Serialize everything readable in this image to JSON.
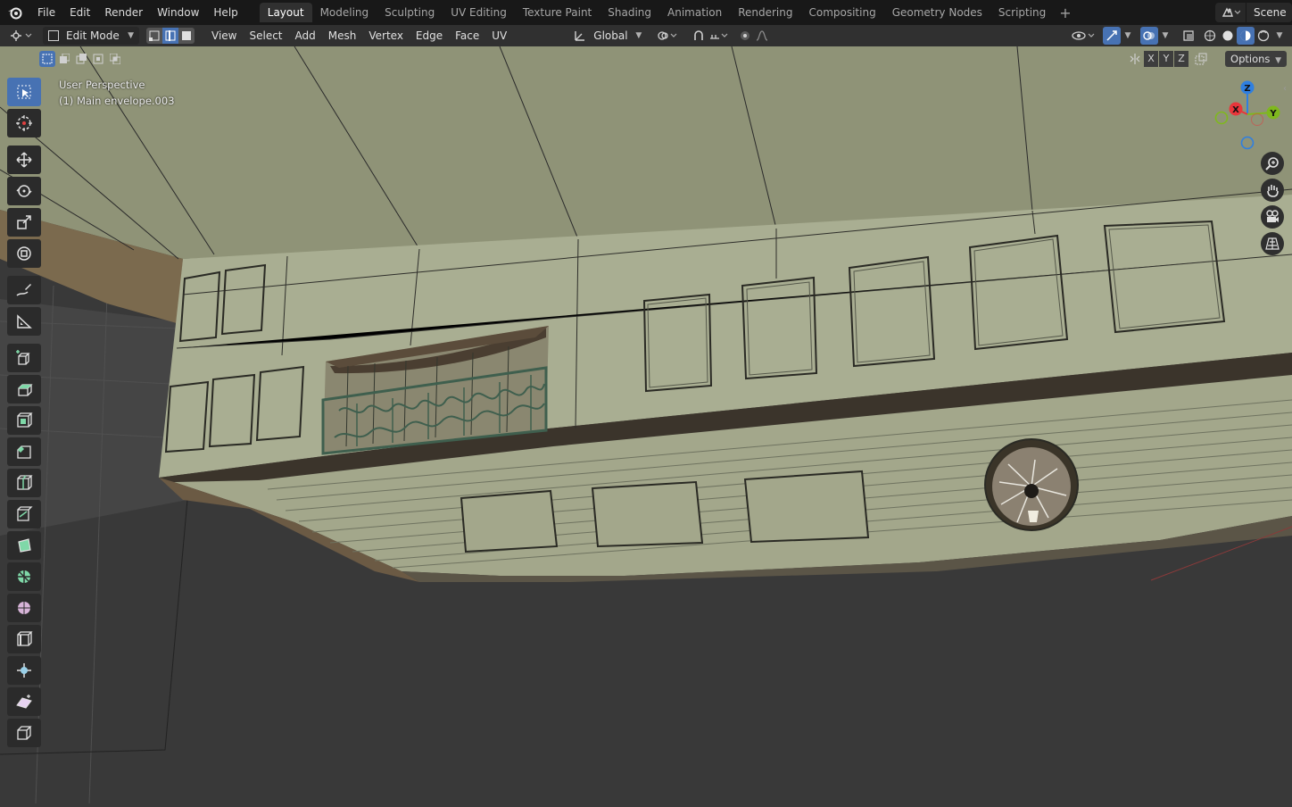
{
  "topbar": {
    "menus": [
      "File",
      "Edit",
      "Render",
      "Window",
      "Help"
    ],
    "workspaces": [
      "Layout",
      "Modeling",
      "Sculpting",
      "UV Editing",
      "Texture Paint",
      "Shading",
      "Animation",
      "Rendering",
      "Compositing",
      "Geometry Nodes",
      "Scripting"
    ],
    "active_workspace": "Layout",
    "scene_label": "Scene"
  },
  "header": {
    "mode": "Edit Mode",
    "menus": [
      "View",
      "Select",
      "Add",
      "Mesh",
      "Vertex",
      "Edge",
      "Face",
      "UV"
    ],
    "transform_orientation": "Global",
    "active_select_mode": "edge"
  },
  "viewport": {
    "perspective_label": "User Perspective",
    "object_label": "(1) Main envelope.003",
    "axis_lock": [
      "X",
      "Y",
      "Z"
    ],
    "options_label": "Options",
    "gizmo_axes": [
      "Z",
      "X",
      "Y"
    ]
  },
  "tools": [
    {
      "name": "select-box",
      "active": true
    },
    {
      "name": "cursor",
      "active": false
    },
    {
      "name": "move",
      "active": false
    },
    {
      "name": "rotate",
      "active": false
    },
    {
      "name": "scale",
      "active": false
    },
    {
      "name": "transform",
      "active": false
    },
    {
      "name": "annotate",
      "active": false
    },
    {
      "name": "measure",
      "active": false
    },
    {
      "name": "add-cube",
      "active": false
    },
    {
      "name": "extrude-region",
      "active": false
    },
    {
      "name": "inset-faces",
      "active": false
    },
    {
      "name": "bevel",
      "active": false
    },
    {
      "name": "loop-cut",
      "active": false
    },
    {
      "name": "knife",
      "active": false
    },
    {
      "name": "poly-build",
      "active": false
    },
    {
      "name": "spin",
      "active": false
    },
    {
      "name": "smooth",
      "active": false
    },
    {
      "name": "edge-slide",
      "active": false
    },
    {
      "name": "shrink-fatten",
      "active": false
    },
    {
      "name": "shear",
      "active": false
    },
    {
      "name": "rip-region",
      "active": false
    }
  ],
  "colors": {
    "accent": "#4772b3",
    "topbar_bg": "#181818",
    "header_bg": "#303030",
    "mesh_face": "#a9ae92",
    "mesh_underside": "#8e9276",
    "axis_x": "#e8363b",
    "axis_y": "#7fb81e",
    "axis_z": "#2f7fe0"
  }
}
